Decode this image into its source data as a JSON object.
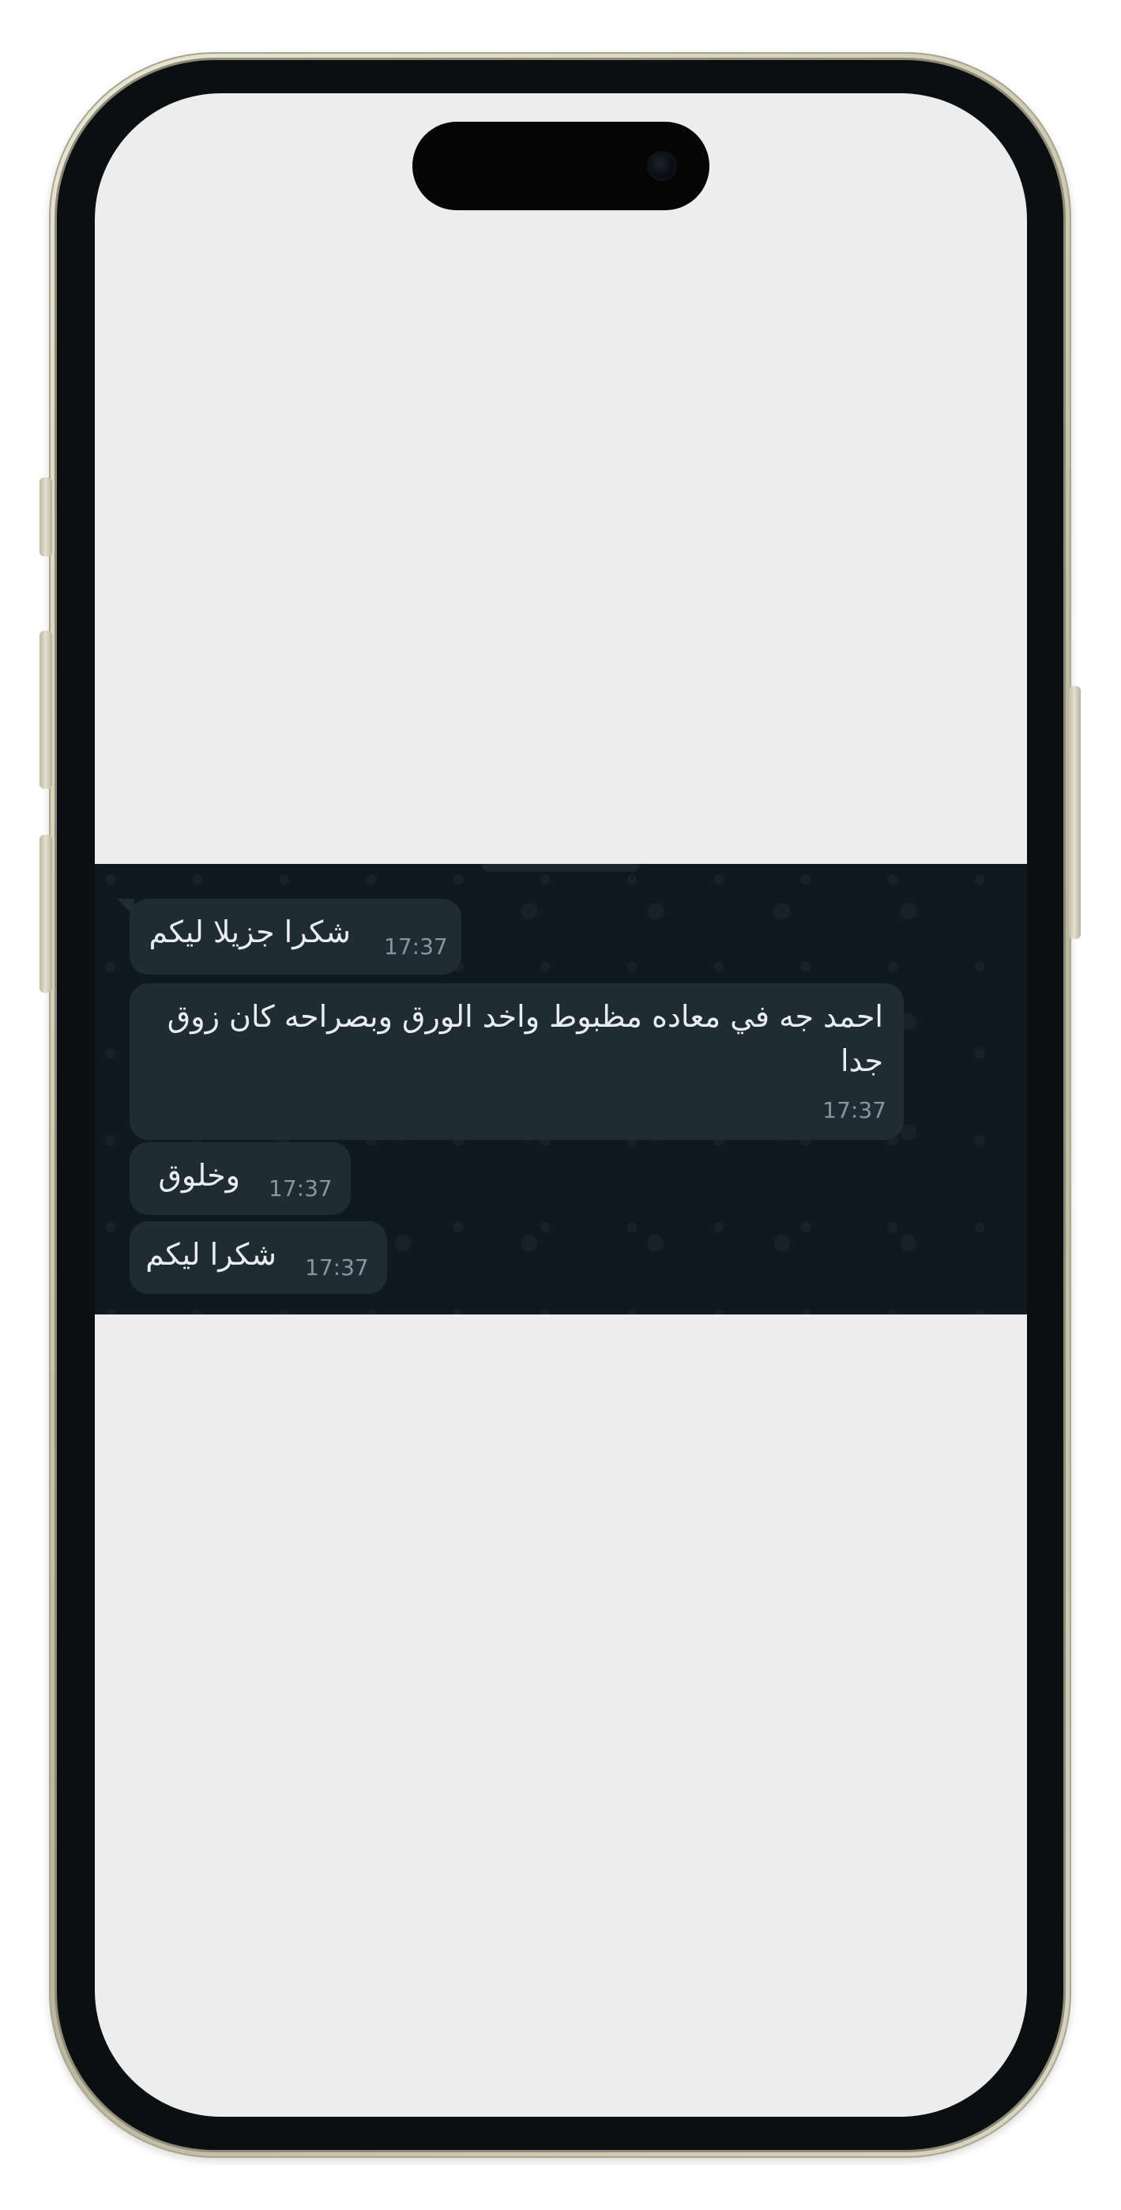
{
  "chat": {
    "messages": [
      {
        "text": "شكرا جزيلا ليكم",
        "time": "17:37"
      },
      {
        "text": "احمد جه في معاده مظبوط واخد الورق وبصراحه كان زوق جدا",
        "time": "17:37"
      },
      {
        "text": "وخلوق",
        "time": "17:37"
      },
      {
        "text": "شكرا ليكم",
        "time": "17:37"
      }
    ],
    "colors": {
      "background": "#0f1a20",
      "bubble": "#202c33",
      "text": "#e9edef",
      "time": "#8696a0"
    }
  }
}
